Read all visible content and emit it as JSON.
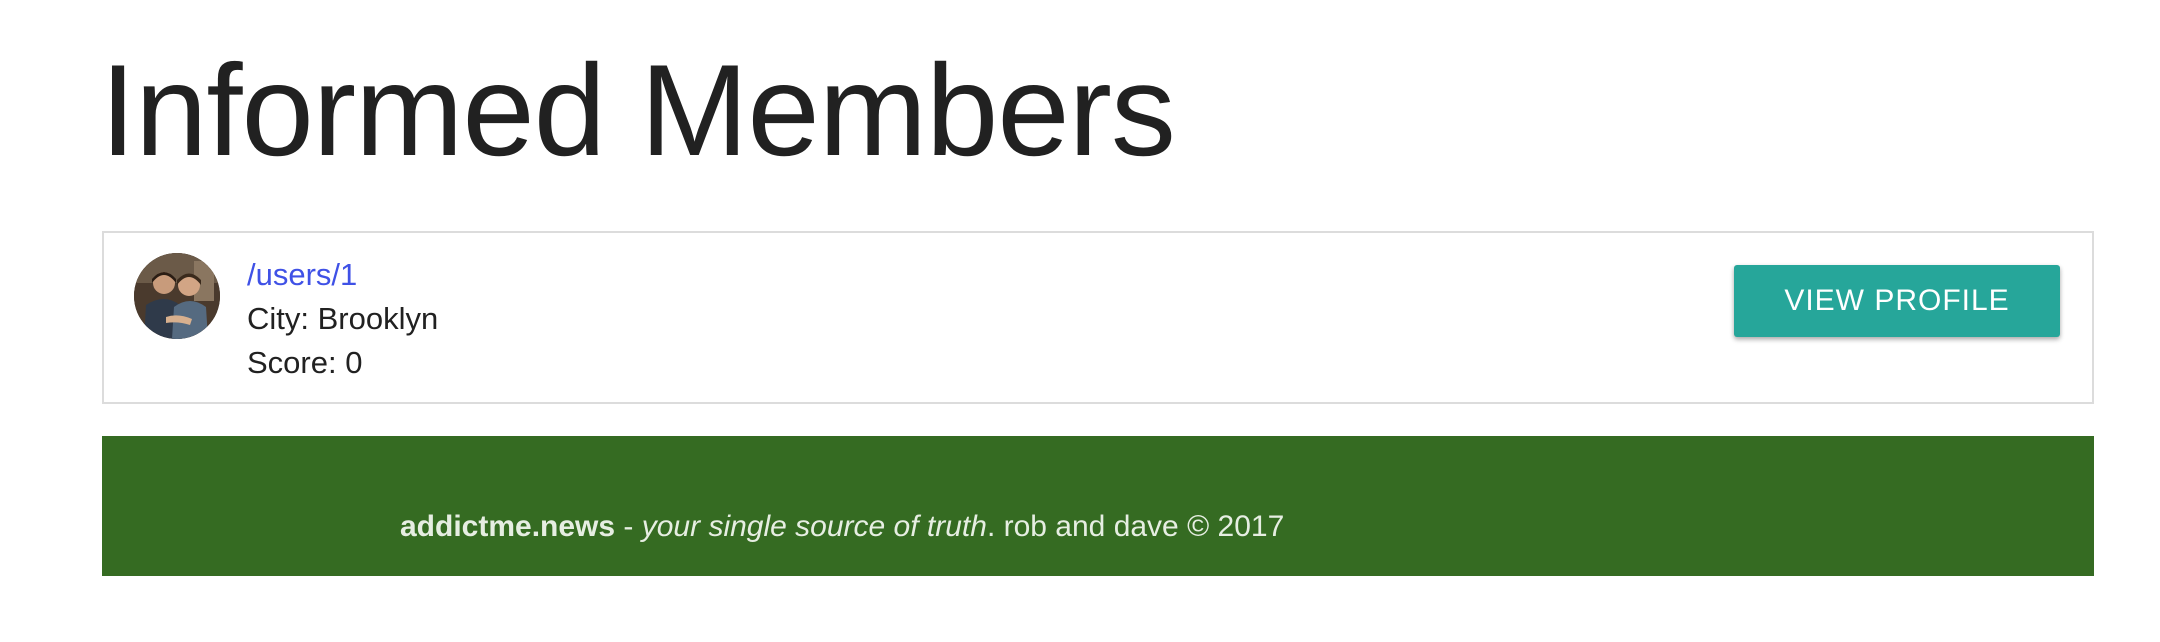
{
  "page": {
    "title": "Informed Members"
  },
  "members": [
    {
      "link_text": "/users/1",
      "city": "City: Brooklyn",
      "score": "Score: 0",
      "button_label": "VIEW PROFILE"
    }
  ],
  "footer": {
    "brand": "addictme.news",
    "separator": " - ",
    "tagline": "your single source of truth",
    "credit": ". rob and dave © 2017"
  },
  "colors": {
    "link": "#3f51e6",
    "button": "#26a69a",
    "footer_bg": "#356b22",
    "title_text": "#212121"
  },
  "icons": {
    "avatar": "user-avatar-photo"
  }
}
